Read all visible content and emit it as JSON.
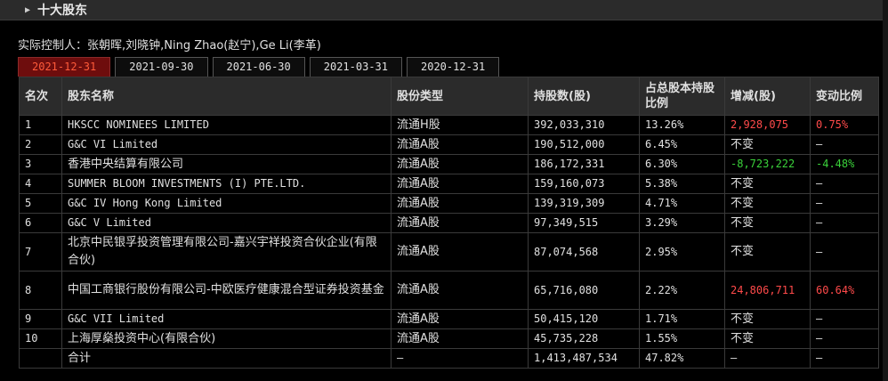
{
  "section": {
    "title": "十大股东"
  },
  "controller": "实际控制人：张朝晖,刘晓钟,Ning Zhao(赵宁),Ge Li(李革)",
  "tabs": [
    "2021-12-31",
    "2021-09-30",
    "2021-06-30",
    "2021-03-31",
    "2020-12-31"
  ],
  "active_tab": "2021-12-31",
  "headers": [
    "名次",
    "股东名称",
    "股份类型",
    "持股数(股)",
    "占总股本持股比例",
    "增减(股)",
    "变动比例"
  ],
  "rows": [
    {
      "rank": "1",
      "name": "HKSCC NOMINEES LIMITED",
      "type": "流通H股",
      "shares": "392,033,310",
      "pct": "13.26%",
      "change": "2,928,075",
      "change_pct": "0.75%",
      "dir": "up"
    },
    {
      "rank": "2",
      "name": "G&C VI Limited",
      "type": "流通A股",
      "shares": "190,512,000",
      "pct": "6.45%",
      "change": "不变",
      "change_pct": "—",
      "dir": "none"
    },
    {
      "rank": "3",
      "name": "香港中央结算有限公司",
      "type": "流通A股",
      "shares": "186,172,331",
      "pct": "6.30%",
      "change": "-8,723,222",
      "change_pct": "-4.48%",
      "dir": "down"
    },
    {
      "rank": "4",
      "name": "SUMMER BLOOM INVESTMENTS (I) PTE.LTD.",
      "type": "流通A股",
      "shares": "159,160,073",
      "pct": "5.38%",
      "change": "不变",
      "change_pct": "—",
      "dir": "none"
    },
    {
      "rank": "5",
      "name": "G&C IV Hong Kong Limited",
      "type": "流通A股",
      "shares": "139,319,309",
      "pct": "4.71%",
      "change": "不变",
      "change_pct": "—",
      "dir": "none"
    },
    {
      "rank": "6",
      "name": "G&C V Limited",
      "type": "流通A股",
      "shares": "97,349,515",
      "pct": "3.29%",
      "change": "不变",
      "change_pct": "—",
      "dir": "none"
    },
    {
      "rank": "7",
      "name": "北京中民银孚投资管理有限公司-嘉兴宇祥投资合伙企业(有限合伙)",
      "type": "流通A股",
      "shares": "87,074,568",
      "pct": "2.95%",
      "change": "不变",
      "change_pct": "—",
      "dir": "none"
    },
    {
      "rank": "8",
      "name": "中国工商银行股份有限公司-中欧医疗健康混合型证券投资基金",
      "type": "流通A股",
      "shares": "65,716,080",
      "pct": "2.22%",
      "change": "24,806,711",
      "change_pct": "60.64%",
      "dir": "up"
    },
    {
      "rank": "9",
      "name": "G&C VII Limited",
      "type": "流通A股",
      "shares": "50,415,120",
      "pct": "1.71%",
      "change": "不变",
      "change_pct": "—",
      "dir": "none"
    },
    {
      "rank": "10",
      "name": "上海厚燊投资中心(有限合伙)",
      "type": "流通A股",
      "shares": "45,735,228",
      "pct": "1.55%",
      "change": "不变",
      "change_pct": "—",
      "dir": "none"
    }
  ],
  "total": {
    "label": "合计",
    "type": "—",
    "shares": "1,413,487,534",
    "pct": "47.82%",
    "change": "—",
    "change_pct": "—"
  },
  "colors": {
    "active_tab_bg": "#6e0d0d",
    "active_tab_text": "#ff5b3a",
    "up": "#ff4a4a",
    "down": "#3ad13a"
  }
}
